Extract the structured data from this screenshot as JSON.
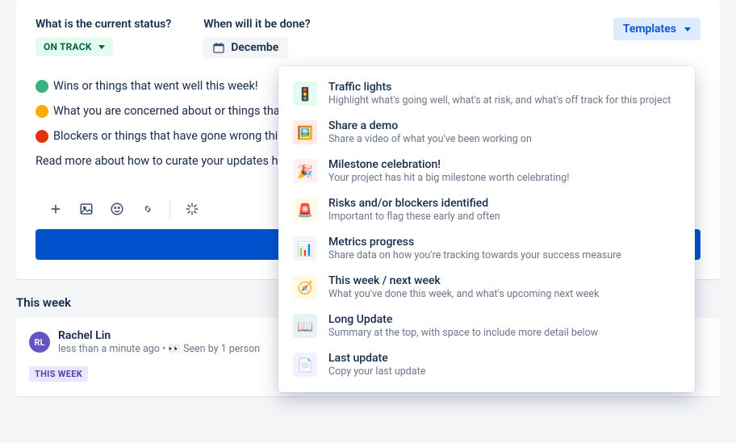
{
  "status": {
    "question": "What is the current status?",
    "value": "ON TRACK"
  },
  "done": {
    "question": "When will it be done?",
    "value": "Decembe"
  },
  "templates_button": "Templates",
  "bullets": [
    {
      "color": "#36b37e",
      "text": "Wins or things that went well this week!"
    },
    {
      "color": "#ffab00",
      "text": "What you are concerned about or things tha"
    },
    {
      "color": "#de350b",
      "text": "Blockers or things that have gone wrong thi"
    }
  ],
  "read_more": "Read more about how to curate your updates h",
  "submit_label": "",
  "section_heading": "This week",
  "entry": {
    "initials": "RL",
    "author": "Rachel Lin",
    "meta_prefix": "less than a minute ago • ",
    "eyes": "👀",
    "meta_suffix": " Seen by 1 person",
    "tag": "THIS WEEK"
  },
  "templates": [
    {
      "emoji": "🚦",
      "bg": "#e3fcef",
      "title": "Traffic lights",
      "desc": "Highlight what's going well, what's at risk, and what's off track for this project"
    },
    {
      "emoji": "🖼️",
      "bg": "#ffebe6",
      "title": "Share a demo",
      "desc": "Share a video of what you've been working on"
    },
    {
      "emoji": "🎉",
      "bg": "#fff0f5",
      "title": "Milestone celebration!",
      "desc": "Your project has hit a big milestone worth celebrating!"
    },
    {
      "emoji": "🚨",
      "bg": "#fffae6",
      "title": "Risks and/or blockers identified",
      "desc": "Important to flag these early and often"
    },
    {
      "emoji": "📊",
      "bg": "#f4f5f7",
      "title": "Metrics progress",
      "desc": "Share data on how you're tracking towards your success measure"
    },
    {
      "emoji": "🧭",
      "bg": "#fffae6",
      "title": "This week / next week",
      "desc": "What you've done this week, and what's upcoming next week"
    },
    {
      "emoji": "📖",
      "bg": "#e6f2f5",
      "title": "Long Update",
      "desc": "Summary at the top, with space to include more detail below"
    },
    {
      "emoji": "📄",
      "bg": "#f3f0ff",
      "title": "Last update",
      "desc": "Copy your last update"
    }
  ]
}
